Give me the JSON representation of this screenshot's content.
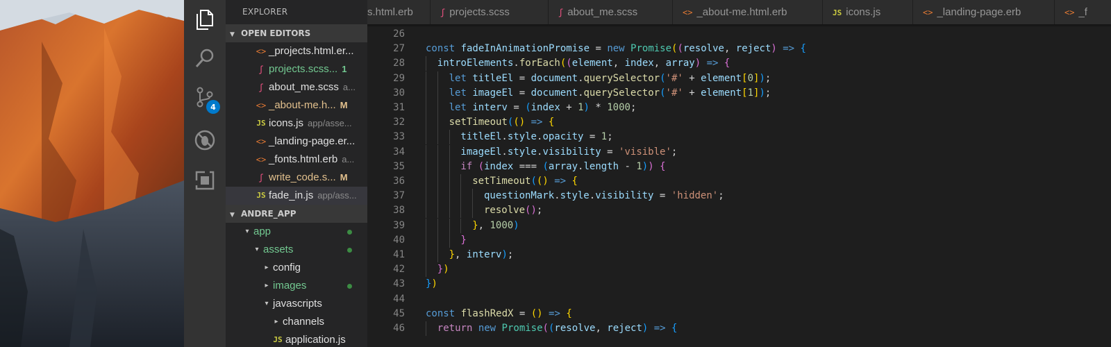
{
  "sidebar": {
    "title": "EXPLORER",
    "open_editors_header": "OPEN EDITORS",
    "project_header": "ANDRE_APP",
    "open_editors": [
      {
        "icon": "html",
        "name": "_projects.html.er...",
        "desc": "",
        "status": "",
        "name_color": "#e0e0e0"
      },
      {
        "icon": "scss",
        "name": "projects.scss...",
        "desc": "",
        "status": "1",
        "name_color": "#73c991",
        "status_color": "#73c991"
      },
      {
        "icon": "scss",
        "name": "about_me.scss",
        "desc": "a...",
        "status": "",
        "name_color": "#e0e0e0"
      },
      {
        "icon": "html",
        "name": "_about-me.h...",
        "desc": "",
        "status": "M",
        "name_color": "#e2c08d",
        "status_color": "#e2c08d"
      },
      {
        "icon": "js",
        "name": "icons.js",
        "desc": "app/asse...",
        "status": "",
        "name_color": "#e0e0e0"
      },
      {
        "icon": "html",
        "name": "_landing-page.er...",
        "desc": "",
        "status": "",
        "name_color": "#e0e0e0"
      },
      {
        "icon": "html",
        "name": "_fonts.html.erb",
        "desc": "a...",
        "status": "",
        "name_color": "#e0e0e0"
      },
      {
        "icon": "scss",
        "name": "write_code.s...",
        "desc": "",
        "status": "M",
        "name_color": "#e2c08d",
        "status_color": "#e2c08d"
      },
      {
        "icon": "js",
        "name": "fade_in.js",
        "desc": "app/ass...",
        "status": "",
        "name_color": "#e0e0e0",
        "selected": true
      }
    ],
    "tree": [
      {
        "label": "app",
        "caret": "▾",
        "depth": 0,
        "color": "#73c991",
        "dot": true
      },
      {
        "label": "assets",
        "caret": "▾",
        "depth": 1,
        "color": "#73c991",
        "dot": true
      },
      {
        "label": "config",
        "caret": "▸",
        "depth": 2,
        "color": "#e0e0e0",
        "dot": false
      },
      {
        "label": "images",
        "caret": "▸",
        "depth": 2,
        "color": "#73c991",
        "dot": true
      },
      {
        "label": "javascripts",
        "caret": "▾",
        "depth": 2,
        "color": "#e0e0e0",
        "dot": false
      },
      {
        "label": "channels",
        "caret": "▸",
        "depth": 3,
        "color": "#e0e0e0",
        "dot": false
      },
      {
        "label": "application.js",
        "caret": "",
        "depth": 3,
        "color": "#e0e0e0",
        "dot": false,
        "icon": "js"
      }
    ]
  },
  "activity_bar": {
    "items": [
      {
        "name": "explorer",
        "icon": "files-icon"
      },
      {
        "name": "search",
        "icon": "search-icon"
      },
      {
        "name": "source-control",
        "icon": "source-control-icon",
        "badge": "4"
      },
      {
        "name": "debug",
        "icon": "debug-icon"
      },
      {
        "name": "extensions",
        "icon": "extensions-icon"
      }
    ]
  },
  "tabs": [
    {
      "label": "s.html.erb",
      "icon": "",
      "icon_type": ""
    },
    {
      "label": "projects.scss",
      "icon": "ʃ",
      "icon_type": "scss"
    },
    {
      "label": "about_me.scss",
      "icon": "ʃ",
      "icon_type": "scss"
    },
    {
      "label": "_about-me.html.erb",
      "icon": "<>",
      "icon_type": "html"
    },
    {
      "label": "icons.js",
      "icon": "JS",
      "icon_type": "js"
    },
    {
      "label": "_landing-page.erb",
      "icon": "<>",
      "icon_type": "html"
    },
    {
      "label": "_f",
      "icon": "<>",
      "icon_type": "html"
    }
  ],
  "editor": {
    "lines": [
      {
        "n": "26",
        "indent": 0,
        "tokens": []
      },
      {
        "n": "27",
        "indent": 0,
        "tokens": [
          [
            "kw",
            "const "
          ],
          [
            "var",
            "fadeInAnimationPromise"
          ],
          [
            "op",
            " = "
          ],
          [
            "kw",
            "new "
          ],
          [
            "cls",
            "Promise"
          ],
          [
            "p1",
            "("
          ],
          [
            "p2",
            "("
          ],
          [
            "var",
            "resolve"
          ],
          [
            "op",
            ", "
          ],
          [
            "var",
            "reject"
          ],
          [
            "p2",
            ")"
          ],
          [
            "ar",
            " => "
          ],
          [
            "p3",
            "{"
          ]
        ]
      },
      {
        "n": "28",
        "indent": 1,
        "tokens": [
          [
            "var",
            "introElements"
          ],
          [
            "op",
            "."
          ],
          [
            "fn",
            "forEach"
          ],
          [
            "p1",
            "("
          ],
          [
            "p2",
            "("
          ],
          [
            "var",
            "element"
          ],
          [
            "op",
            ", "
          ],
          [
            "var",
            "index"
          ],
          [
            "op",
            ", "
          ],
          [
            "var",
            "array"
          ],
          [
            "p2",
            ")"
          ],
          [
            "ar",
            " => "
          ],
          [
            "p2",
            "{"
          ]
        ]
      },
      {
        "n": "29",
        "indent": 2,
        "tokens": [
          [
            "kw",
            "let "
          ],
          [
            "var",
            "titleEl"
          ],
          [
            "op",
            " = "
          ],
          [
            "var",
            "document"
          ],
          [
            "op",
            "."
          ],
          [
            "fn",
            "querySelector"
          ],
          [
            "p3",
            "("
          ],
          [
            "str",
            "'#'"
          ],
          [
            "op",
            " + "
          ],
          [
            "var",
            "element"
          ],
          [
            "p1",
            "["
          ],
          [
            "num",
            "0"
          ],
          [
            "p1",
            "]"
          ],
          [
            "p3",
            ")"
          ],
          [
            "op",
            ";"
          ]
        ]
      },
      {
        "n": "30",
        "indent": 2,
        "tokens": [
          [
            "kw",
            "let "
          ],
          [
            "var",
            "imageEl"
          ],
          [
            "op",
            " = "
          ],
          [
            "var",
            "document"
          ],
          [
            "op",
            "."
          ],
          [
            "fn",
            "querySelector"
          ],
          [
            "p3",
            "("
          ],
          [
            "str",
            "'#'"
          ],
          [
            "op",
            " + "
          ],
          [
            "var",
            "element"
          ],
          [
            "p1",
            "["
          ],
          [
            "num",
            "1"
          ],
          [
            "p1",
            "]"
          ],
          [
            "p3",
            ")"
          ],
          [
            "op",
            ";"
          ]
        ]
      },
      {
        "n": "31",
        "indent": 2,
        "tokens": [
          [
            "kw",
            "let "
          ],
          [
            "var",
            "interv"
          ],
          [
            "op",
            " = "
          ],
          [
            "p3",
            "("
          ],
          [
            "var",
            "index"
          ],
          [
            "op",
            " + "
          ],
          [
            "num",
            "1"
          ],
          [
            "p3",
            ")"
          ],
          [
            "op",
            " * "
          ],
          [
            "num",
            "1000"
          ],
          [
            "op",
            ";"
          ]
        ]
      },
      {
        "n": "32",
        "indent": 2,
        "tokens": [
          [
            "fn",
            "setTimeout"
          ],
          [
            "p3",
            "("
          ],
          [
            "p1",
            "()"
          ],
          [
            "ar",
            " => "
          ],
          [
            "p1",
            "{"
          ]
        ]
      },
      {
        "n": "33",
        "indent": 3,
        "tokens": [
          [
            "var",
            "titleEl"
          ],
          [
            "op",
            "."
          ],
          [
            "var",
            "style"
          ],
          [
            "op",
            "."
          ],
          [
            "var",
            "opacity"
          ],
          [
            "op",
            " = "
          ],
          [
            "num",
            "1"
          ],
          [
            "op",
            ";"
          ]
        ]
      },
      {
        "n": "34",
        "indent": 3,
        "tokens": [
          [
            "var",
            "imageEl"
          ],
          [
            "op",
            "."
          ],
          [
            "var",
            "style"
          ],
          [
            "op",
            "."
          ],
          [
            "var",
            "visibility"
          ],
          [
            "op",
            " = "
          ],
          [
            "str",
            "'visible'"
          ],
          [
            "op",
            ";"
          ]
        ]
      },
      {
        "n": "35",
        "indent": 3,
        "tokens": [
          [
            "kw2",
            "if "
          ],
          [
            "p2",
            "("
          ],
          [
            "var",
            "index"
          ],
          [
            "op",
            " === "
          ],
          [
            "p3",
            "("
          ],
          [
            "var",
            "array"
          ],
          [
            "op",
            "."
          ],
          [
            "var",
            "length"
          ],
          [
            "op",
            " - "
          ],
          [
            "num",
            "1"
          ],
          [
            "p3",
            ")"
          ],
          [
            "p2",
            ")"
          ],
          [
            "op",
            " "
          ],
          [
            "p2",
            "{"
          ]
        ]
      },
      {
        "n": "36",
        "indent": 4,
        "tokens": [
          [
            "fn",
            "setTimeout"
          ],
          [
            "p3",
            "("
          ],
          [
            "p1",
            "()"
          ],
          [
            "ar",
            " => "
          ],
          [
            "p1",
            "{"
          ]
        ]
      },
      {
        "n": "37",
        "indent": 5,
        "tokens": [
          [
            "var",
            "questionMark"
          ],
          [
            "op",
            "."
          ],
          [
            "var",
            "style"
          ],
          [
            "op",
            "."
          ],
          [
            "var",
            "visibility"
          ],
          [
            "op",
            " = "
          ],
          [
            "str",
            "'hidden'"
          ],
          [
            "op",
            ";"
          ]
        ]
      },
      {
        "n": "38",
        "indent": 5,
        "tokens": [
          [
            "fn",
            "resolve"
          ],
          [
            "p2",
            "()"
          ],
          [
            "op",
            ";"
          ]
        ]
      },
      {
        "n": "39",
        "indent": 4,
        "tokens": [
          [
            "p1",
            "}"
          ],
          [
            "op",
            ", "
          ],
          [
            "num",
            "1000"
          ],
          [
            "p3",
            ")"
          ]
        ]
      },
      {
        "n": "40",
        "indent": 3,
        "tokens": [
          [
            "p2",
            "}"
          ]
        ]
      },
      {
        "n": "41",
        "indent": 2,
        "tokens": [
          [
            "p1",
            "}"
          ],
          [
            "op",
            ", "
          ],
          [
            "var",
            "interv"
          ],
          [
            "p3",
            ")"
          ],
          [
            "op",
            ";"
          ]
        ]
      },
      {
        "n": "42",
        "indent": 1,
        "tokens": [
          [
            "p2",
            "}"
          ],
          [
            "p1",
            ")"
          ]
        ]
      },
      {
        "n": "43",
        "indent": 0,
        "tokens": [
          [
            "p3",
            "}"
          ],
          [
            "p1",
            ")"
          ]
        ]
      },
      {
        "n": "44",
        "indent": 0,
        "tokens": []
      },
      {
        "n": "45",
        "indent": 0,
        "tokens": [
          [
            "kw",
            "const "
          ],
          [
            "fn",
            "flashRedX"
          ],
          [
            "op",
            " = "
          ],
          [
            "p1",
            "()"
          ],
          [
            "ar",
            " => "
          ],
          [
            "p1",
            "{"
          ]
        ]
      },
      {
        "n": "46",
        "indent": 1,
        "tokens": [
          [
            "kw2",
            "return "
          ],
          [
            "kw",
            "new "
          ],
          [
            "cls",
            "Promise"
          ],
          [
            "p2",
            "("
          ],
          [
            "p3",
            "("
          ],
          [
            "var",
            "resolve"
          ],
          [
            "op",
            ", "
          ],
          [
            "var",
            "reject"
          ],
          [
            "p3",
            ")"
          ],
          [
            "ar",
            " => "
          ],
          [
            "p3",
            "{"
          ]
        ]
      }
    ]
  }
}
